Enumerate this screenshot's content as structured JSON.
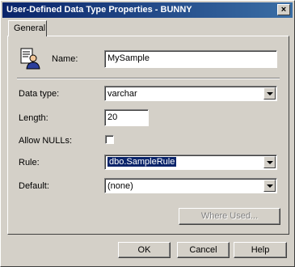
{
  "window": {
    "title": "User-Defined Data Type Properties - BUNNY",
    "close_glyph": "×"
  },
  "tabs": [
    {
      "label": "General"
    }
  ],
  "general": {
    "icon": "data-type-icon",
    "name_label": "Name:",
    "name_value": "MySample",
    "data_type_label": "Data type:",
    "data_type_value": "varchar",
    "length_label": "Length:",
    "length_value": "20",
    "allow_nulls_label": "Allow NULLs:",
    "allow_nulls_checked": false,
    "rule_label": "Rule:",
    "rule_value": "dbo.SampleRule",
    "default_label": "Default:",
    "default_value": "(none)",
    "where_used_label": "Where Used..."
  },
  "footer": {
    "ok_label": "OK",
    "cancel_label": "Cancel",
    "help_label": "Help"
  },
  "colors": {
    "face": "#d4d0c8",
    "titlebar": "#0a246a",
    "highlight": "#0a246a"
  }
}
